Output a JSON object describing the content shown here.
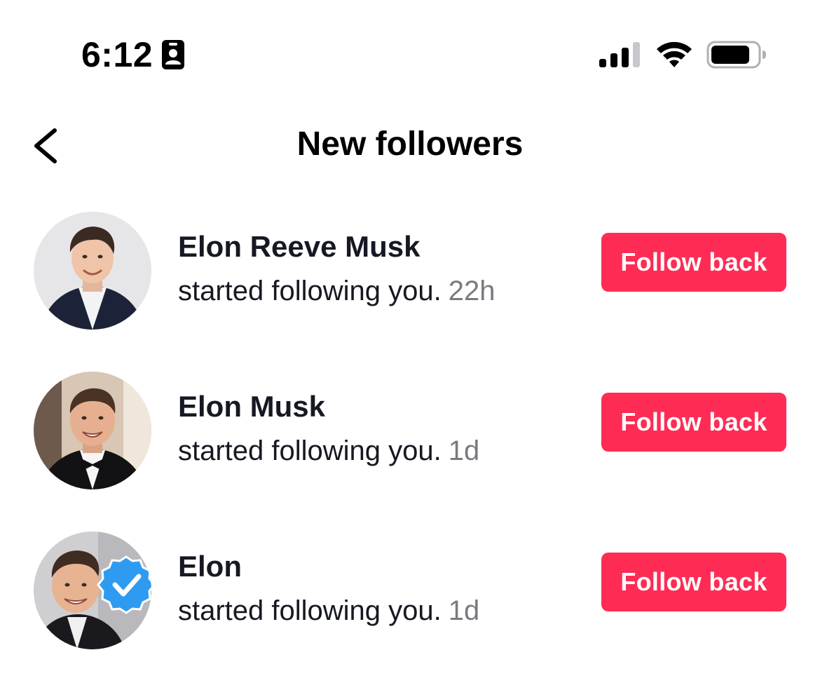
{
  "status_bar": {
    "time": "6:12",
    "icons": [
      "contact-card-icon",
      "cellular-signal-icon",
      "wifi-icon",
      "battery-icon"
    ]
  },
  "header": {
    "back_icon": "chevron-left-icon",
    "title": "New followers"
  },
  "colors": {
    "accent": "#fe2c55",
    "text_primary": "#161823",
    "text_secondary": "#7a7a80",
    "background": "#ffffff"
  },
  "followers": [
    {
      "name": "Elon Reeve Musk",
      "activity": "started following you.",
      "time": "22h",
      "button_label": "Follow back"
    },
    {
      "name": "Elon Musk",
      "activity": "started following you.",
      "time": "1d",
      "button_label": "Follow back"
    },
    {
      "name": "Elon",
      "activity": "started following you.",
      "time": "1d",
      "button_label": "Follow back",
      "verified_badge": "verified-badge-icon"
    }
  ]
}
